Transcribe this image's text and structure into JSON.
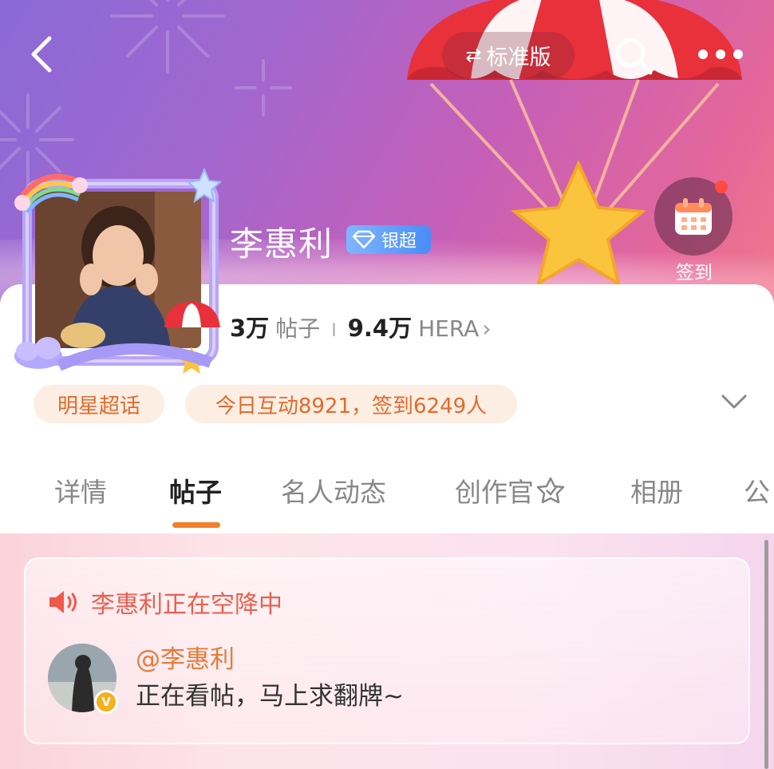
{
  "header": {
    "version_label": "标准版"
  },
  "checkin": {
    "label": "签到"
  },
  "profile": {
    "name": "李惠利",
    "badge": "银超",
    "posts_count": "3万",
    "posts_label": "帖子",
    "fans_count": "9.4万",
    "fans_label": "HERA",
    "fans_chevron": "›"
  },
  "tags": {
    "category": "明星超话",
    "activity": "今日互动8921，签到6249人"
  },
  "tabs": [
    {
      "label": "详情"
    },
    {
      "label": "帖子"
    },
    {
      "label": "名人动态"
    },
    {
      "label": "创作官"
    },
    {
      "label": "相册"
    },
    {
      "label": "公"
    }
  ],
  "active_tab": "帖子",
  "airdrop": {
    "title": "李惠利正在空降中",
    "mention": "@李惠利",
    "message": "正在看帖，马上求翻牌~",
    "verified_badge": "V"
  },
  "colors": {
    "accent_orange": "#f0802a",
    "tag_bg": "#fdeee3",
    "tag_text": "#e26a2c",
    "airdrop_title": "#e9604e"
  }
}
